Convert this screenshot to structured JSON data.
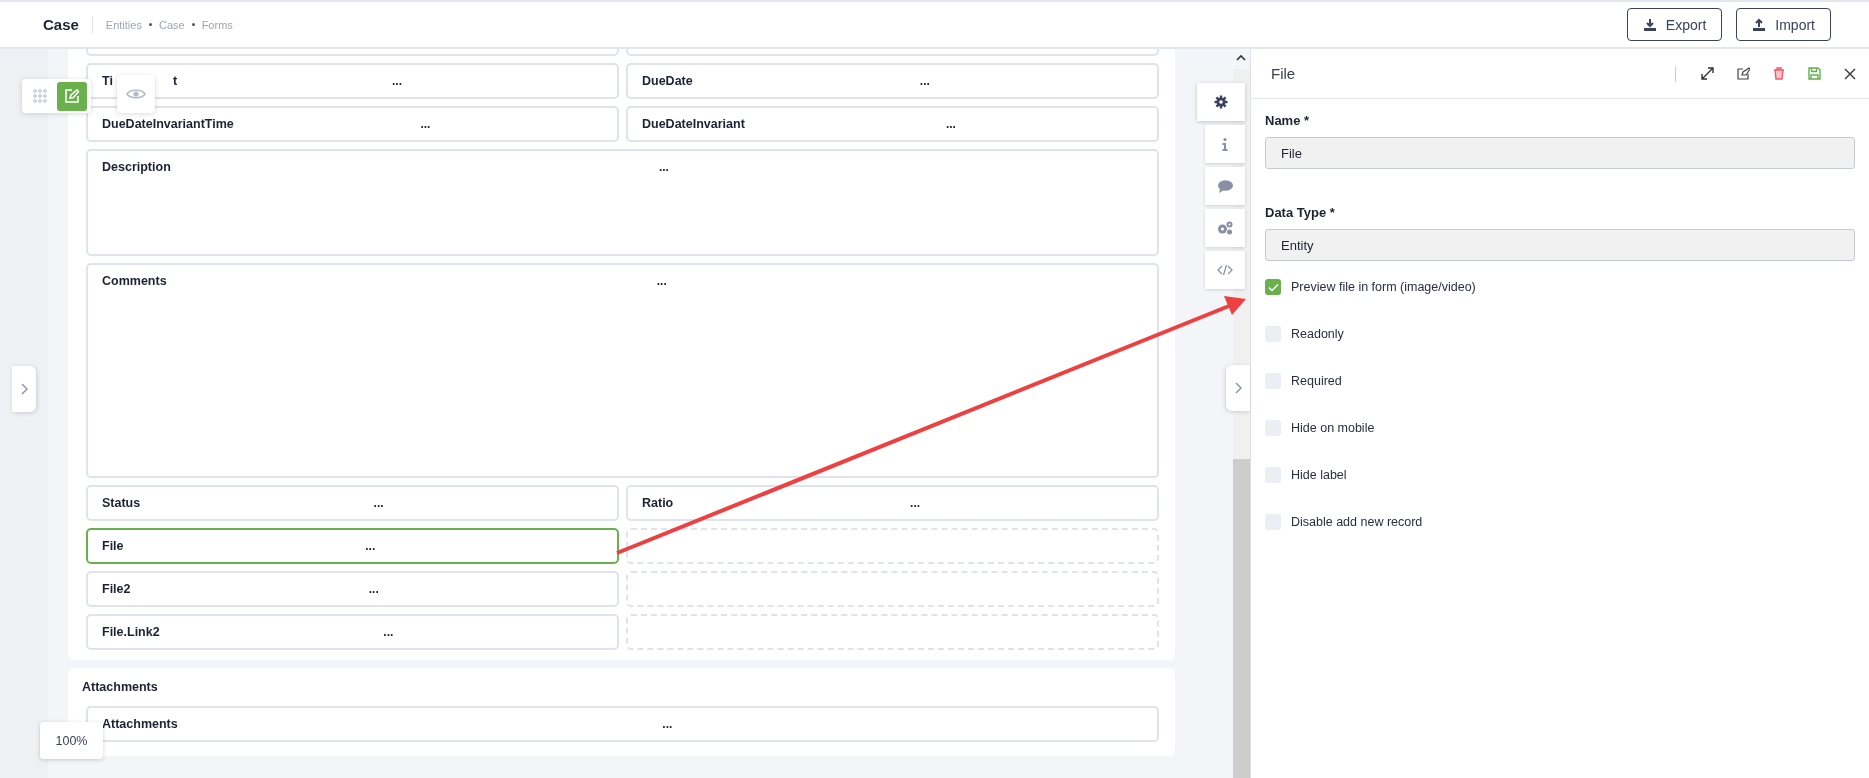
{
  "header": {
    "title": "Case",
    "breadcrumb": [
      "Entities",
      "Case",
      "Forms"
    ],
    "buttons": [
      {
        "label": "Export",
        "kind": "export"
      },
      {
        "label": "Import",
        "kind": "import"
      }
    ]
  },
  "form": {
    "rows": [
      {
        "cells": [
          {
            "kind": "clipped"
          },
          {
            "kind": "clipped"
          }
        ]
      },
      {
        "cells": [
          {
            "kind": "field",
            "label_fragments": [
              "Ti",
              "t"
            ],
            "menu": "...",
            "selected": false
          },
          {
            "kind": "field",
            "label": "DueDate",
            "menu": "...",
            "selected": false
          }
        ]
      },
      {
        "cells": [
          {
            "kind": "field",
            "label": "DueDateInvariantTime",
            "menu": "...",
            "selected": false
          },
          {
            "kind": "field",
            "label": "DueDateInvariant",
            "menu": "...",
            "selected": false
          }
        ]
      },
      {
        "cells": [
          {
            "kind": "text-area",
            "label": "Description",
            "menu": "...",
            "selected": false
          }
        ]
      },
      {
        "cells": [
          {
            "kind": "large-text-area",
            "label": "Comments",
            "menu": "...",
            "selected": false
          }
        ]
      },
      {
        "cells": [
          {
            "kind": "field",
            "label": "Status",
            "menu": "...",
            "selected": false
          },
          {
            "kind": "field",
            "label": "Ratio",
            "menu": "...",
            "selected": false
          }
        ]
      },
      {
        "cells": [
          {
            "kind": "field",
            "label": "File",
            "menu": "...",
            "selected": true
          },
          {
            "kind": "empty"
          }
        ]
      },
      {
        "cells": [
          {
            "kind": "field",
            "label": "File2",
            "menu": "...",
            "selected": false
          },
          {
            "kind": "empty"
          }
        ]
      },
      {
        "cells": [
          {
            "kind": "field",
            "label": "File.Link2",
            "menu": "...",
            "selected": false
          },
          {
            "kind": "empty"
          }
        ]
      }
    ]
  },
  "attachments": {
    "title": "Attachments",
    "rows": [
      {
        "cells": [
          {
            "kind": "field",
            "label": "Attachments",
            "menu": "...",
            "selected": false
          }
        ]
      }
    ]
  },
  "zoom": "100%",
  "side_tabs": [
    {
      "kind": "gear",
      "selected": true
    },
    {
      "kind": "info",
      "selected": false
    },
    {
      "kind": "comment",
      "selected": false
    },
    {
      "kind": "gears",
      "selected": false
    },
    {
      "kind": "code",
      "selected": false
    }
  ],
  "panel": {
    "title": "File",
    "fields": [
      {
        "label": "Name *",
        "value": "File"
      },
      {
        "label": "Data Type *",
        "value": "Entity"
      }
    ],
    "options": [
      {
        "label": "Preview file in form (image/video)",
        "checked": true
      },
      {
        "label": "Readonly",
        "checked": false
      },
      {
        "label": "Required",
        "checked": false
      },
      {
        "label": "Hide on mobile",
        "checked": false
      },
      {
        "label": "Hide label",
        "checked": false
      },
      {
        "label": "Disable add new record",
        "checked": false
      }
    ]
  }
}
